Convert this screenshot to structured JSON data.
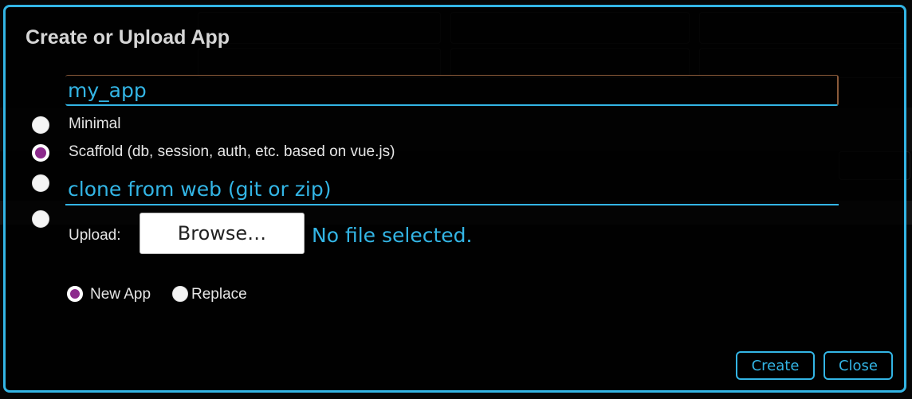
{
  "modal": {
    "title": "Create or Upload App",
    "app_name_value": "my_app",
    "options": {
      "minimal": "Minimal",
      "scaffold": "Scaffold (db, session, auth, etc. based on vue.js)",
      "selected": "scaffold"
    },
    "clone_placeholder": "clone from web (git or zip)",
    "upload": {
      "label": "Upload:",
      "browse_label": "Browse…",
      "file_status": "No file selected."
    },
    "upload_mode": {
      "new_app": "New App",
      "replace": "Replace",
      "selected": "new_app"
    },
    "buttons": {
      "create": "Create",
      "close": "Close"
    }
  },
  "colors": {
    "accent": "#33b5e5",
    "radio_selected": "#8c2a8c",
    "text": "#e6e6e6"
  }
}
